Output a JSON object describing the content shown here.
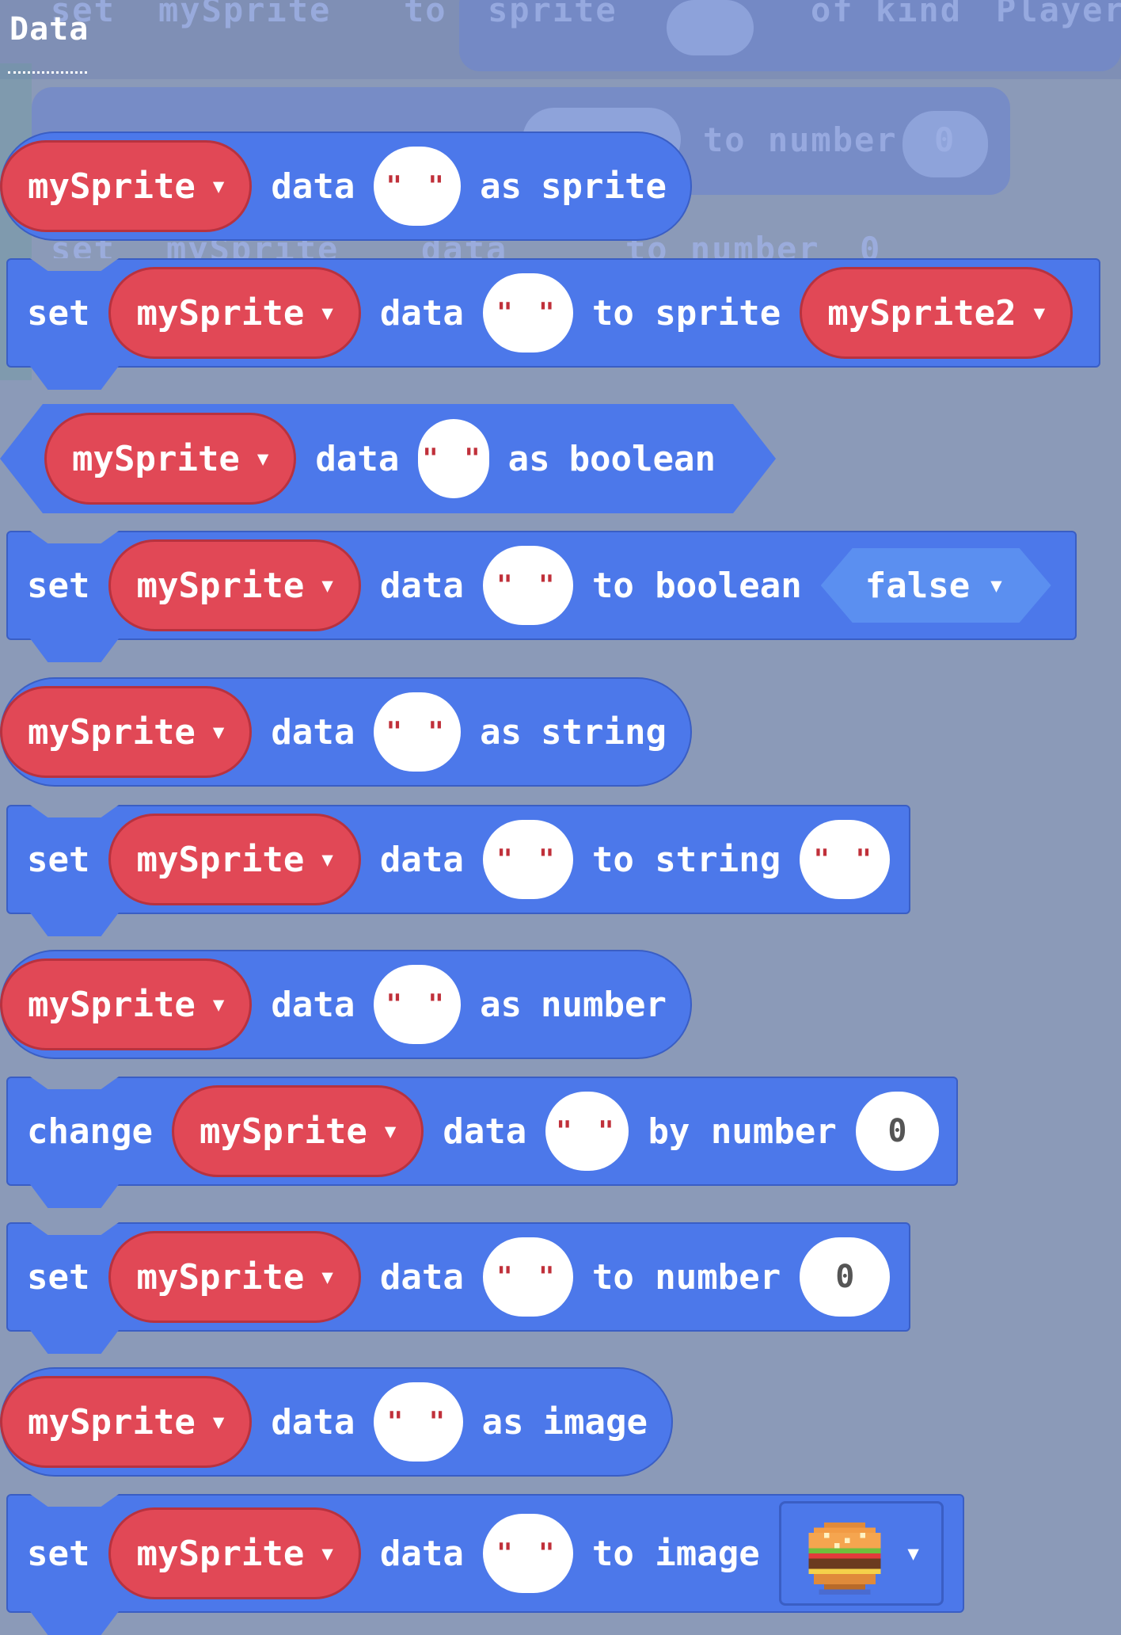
{
  "category": {
    "title": "Data"
  },
  "background_ghost": {
    "row1": [
      "set",
      "mySprite",
      "to",
      "sprite",
      "of kind",
      "Player"
    ],
    "row2": [
      "to number",
      "0"
    ],
    "row3": [
      "set",
      "mySprite",
      "data",
      "to number",
      "0"
    ]
  },
  "common": {
    "sprite_var": "mySprite",
    "data_word": "data",
    "empty_string": "\" \""
  },
  "blocks": [
    {
      "kind": "reporter",
      "label_as": "as",
      "type_word": "sprite"
    },
    {
      "kind": "statement",
      "verb": "set",
      "to_label": "to sprite",
      "value": "mySprite2"
    },
    {
      "kind": "boolean-reporter",
      "label_as": "as",
      "type_word": "boolean"
    },
    {
      "kind": "statement",
      "verb": "set",
      "to_label": "to boolean",
      "value": "false"
    },
    {
      "kind": "reporter",
      "label_as": "as",
      "type_word": "string"
    },
    {
      "kind": "statement",
      "verb": "set",
      "to_label": "to string",
      "value": "\" \""
    },
    {
      "kind": "reporter",
      "label_as": "as",
      "type_word": "number"
    },
    {
      "kind": "statement",
      "verb": "change",
      "to_label": "by number",
      "value": "0"
    },
    {
      "kind": "statement",
      "verb": "set",
      "to_label": "to number",
      "value": "0"
    },
    {
      "kind": "reporter",
      "label_as": "as",
      "type_word": "image"
    },
    {
      "kind": "statement",
      "verb": "set",
      "to_label": "to image",
      "value_icon": "burger-image-icon"
    }
  ],
  "colors": {
    "block_blue": "#4c78ea",
    "sprite_red": "#e14856",
    "bool_blue": "#5b8ff0",
    "background": "#8b9ab8"
  }
}
